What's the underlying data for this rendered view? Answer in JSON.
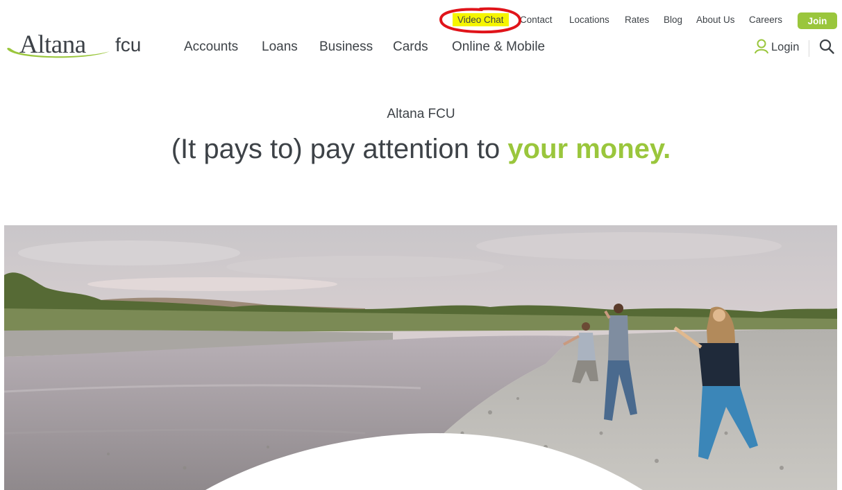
{
  "brand": {
    "logo_name": "Altana",
    "logo_suffix": "fcu",
    "accent_color": "#9ac63c",
    "highlight_color": "#f5f500",
    "annotation_color": "#e0141a"
  },
  "utility_nav": {
    "video_chat": "Video Chat",
    "contact": "Contact",
    "locations": "Locations",
    "rates": "Rates",
    "blog": "Blog",
    "about": "About Us",
    "careers": "Careers",
    "join": "Join"
  },
  "main_nav": {
    "accounts": "Accounts",
    "loans": "Loans",
    "business": "Business",
    "cards": "Cards",
    "online_mobile": "Online & Mobile"
  },
  "header_actions": {
    "login": "Login",
    "login_icon": "user-icon",
    "search_icon": "search-icon"
  },
  "hero": {
    "eyebrow": "Altana FCU",
    "headline_lead": "(It pays to) pay attention to ",
    "headline_accent": "your money.",
    "image_subject": "family skipping stones on a rocky riverbank at dusk"
  }
}
